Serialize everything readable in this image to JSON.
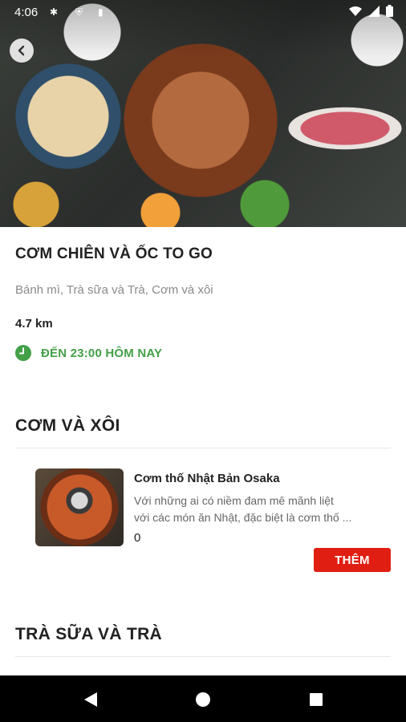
{
  "status_bar": {
    "time": "4:06"
  },
  "restaurant": {
    "name": "CƠM CHIÊN VÀ ỐC TO GO",
    "categories": "Bánh mì, Trà sữa và Trà, Cơm và xôi",
    "distance": "4.7 km",
    "hours": "ĐẾN 23:00 HÔM NAY"
  },
  "sections": [
    {
      "title": "CƠM VÀ XÔI",
      "items": [
        {
          "name": "Cơm thố Nhật Bản Osaka",
          "desc_line1": "Với những ai có niềm đam mê mãnh liệt",
          "desc_line2": "với các món ăn Nhật, đặc biệt là cơm thố ...",
          "price": "0",
          "add_label": "THÊM"
        }
      ]
    },
    {
      "title": "TRÀ SỮA VÀ TRÀ"
    }
  ],
  "colors": {
    "accent_red": "#e01e12",
    "open_green": "#43a047"
  },
  "icons": [
    "back-arrow-icon",
    "clock-icon",
    "wifi-icon",
    "signal-icon",
    "battery-icon",
    "nav-back-icon",
    "nav-home-icon",
    "nav-recents-icon"
  ]
}
